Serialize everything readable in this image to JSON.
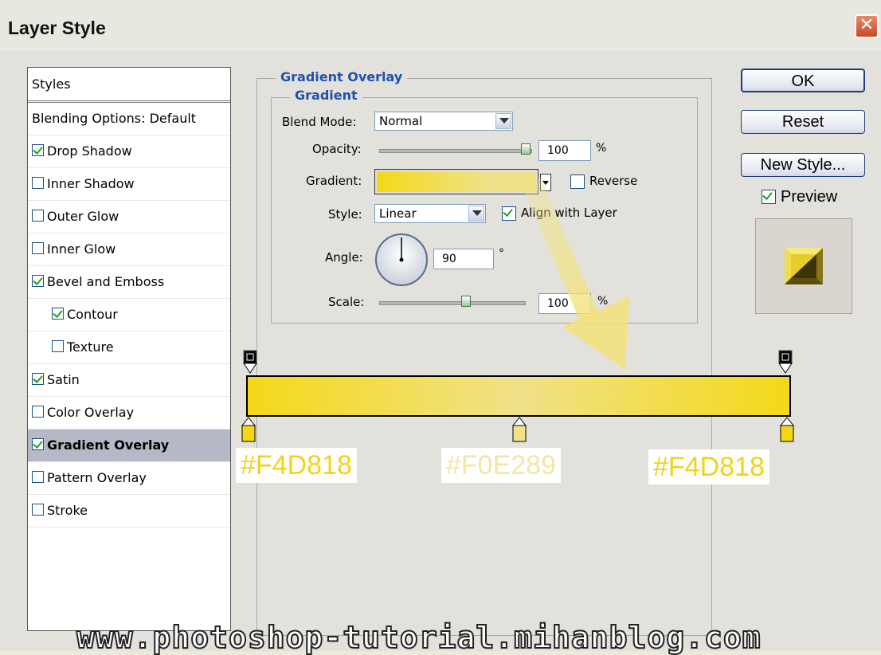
{
  "window": {
    "title": "Layer Style",
    "close_icon": "close-icon"
  },
  "styles_list": {
    "header": "Styles",
    "items": [
      {
        "label": "Blending Options: Default",
        "checkbox": false,
        "checked": false,
        "indent": false,
        "selected": false
      },
      {
        "label": "Drop Shadow",
        "checkbox": true,
        "checked": true,
        "indent": false,
        "selected": false
      },
      {
        "label": "Inner Shadow",
        "checkbox": true,
        "checked": false,
        "indent": false,
        "selected": false
      },
      {
        "label": "Outer Glow",
        "checkbox": true,
        "checked": false,
        "indent": false,
        "selected": false
      },
      {
        "label": "Inner Glow",
        "checkbox": true,
        "checked": false,
        "indent": false,
        "selected": false
      },
      {
        "label": "Bevel and Emboss",
        "checkbox": true,
        "checked": true,
        "indent": false,
        "selected": false
      },
      {
        "label": "Contour",
        "checkbox": true,
        "checked": true,
        "indent": true,
        "selected": false
      },
      {
        "label": "Texture",
        "checkbox": true,
        "checked": false,
        "indent": true,
        "selected": false
      },
      {
        "label": "Satin",
        "checkbox": true,
        "checked": true,
        "indent": false,
        "selected": false
      },
      {
        "label": "Color Overlay",
        "checkbox": true,
        "checked": false,
        "indent": false,
        "selected": false
      },
      {
        "label": "Gradient Overlay",
        "checkbox": true,
        "checked": true,
        "indent": false,
        "selected": true
      },
      {
        "label": "Pattern Overlay",
        "checkbox": true,
        "checked": false,
        "indent": false,
        "selected": false
      },
      {
        "label": "Stroke",
        "checkbox": true,
        "checked": false,
        "indent": false,
        "selected": false
      }
    ]
  },
  "gradient_overlay": {
    "group_title": "Gradient Overlay",
    "subgroup_title": "Gradient",
    "blend_mode_label": "Blend Mode:",
    "blend_mode_value": "Normal",
    "opacity_label": "Opacity:",
    "opacity_value": "100",
    "opacity_unit": "%",
    "opacity_fraction": 1.0,
    "gradient_label": "Gradient:",
    "reverse_label": "Reverse",
    "reverse_checked": false,
    "style_label": "Style:",
    "style_value": "Linear",
    "align_label": "Align with Layer",
    "align_checked": true,
    "angle_label": "Angle:",
    "angle_value": "90",
    "angle_unit": "°",
    "scale_label": "Scale:",
    "scale_value": "100",
    "scale_unit": "%",
    "scale_fraction": 0.6
  },
  "buttons": {
    "ok": "OK",
    "reset": "Reset",
    "new_style": "New Style...",
    "preview_label": "Preview",
    "preview_checked": true
  },
  "gradient_editor": {
    "colors": {
      "left": "#F4D818",
      "mid": "#F0E289",
      "right": "#F4D818"
    },
    "labels": {
      "left": "#F4D818",
      "mid": "#F0E289",
      "right": "#F4D818"
    },
    "label_colors": {
      "left": "#f2d21c",
      "mid": "#f3e6a6",
      "right": "#f2d21c"
    },
    "arrow_color": "#f2e27a"
  },
  "watermark": "www.photoshop-tutorial.mihanblog.com"
}
